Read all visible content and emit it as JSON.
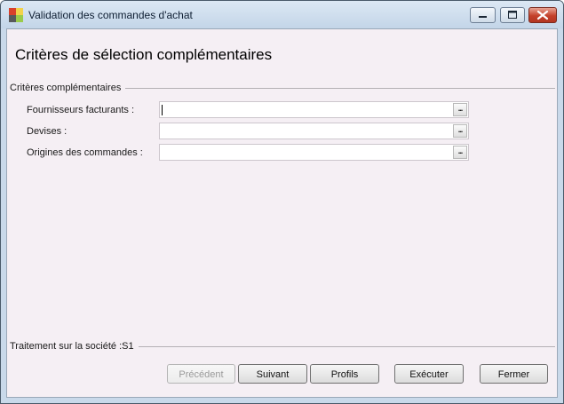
{
  "window": {
    "title": "Validation des commandes d'achat",
    "controls": {
      "minimize": "minimize-icon",
      "maximize": "maximize-icon",
      "close": "close-icon"
    }
  },
  "page": {
    "title": "Critères de sélection complémentaires"
  },
  "criteria": {
    "group_label": "Critères complémentaires",
    "browse_label": "...",
    "fields": [
      {
        "label": "Fournisseurs facturants :",
        "value": ""
      },
      {
        "label": "Devises :",
        "value": ""
      },
      {
        "label": "Origines des commandes :",
        "value": ""
      }
    ]
  },
  "footer": {
    "company_label": "Traitement sur la société :S1",
    "buttons": {
      "previous": "Précédent",
      "next": "Suivant",
      "profiles": "Profils",
      "execute": "Exécuter",
      "close": "Fermer"
    }
  },
  "colors": {
    "client_background": "#f5eff4",
    "titlebar": "#c9d9ea",
    "close_button": "#c4412b"
  }
}
